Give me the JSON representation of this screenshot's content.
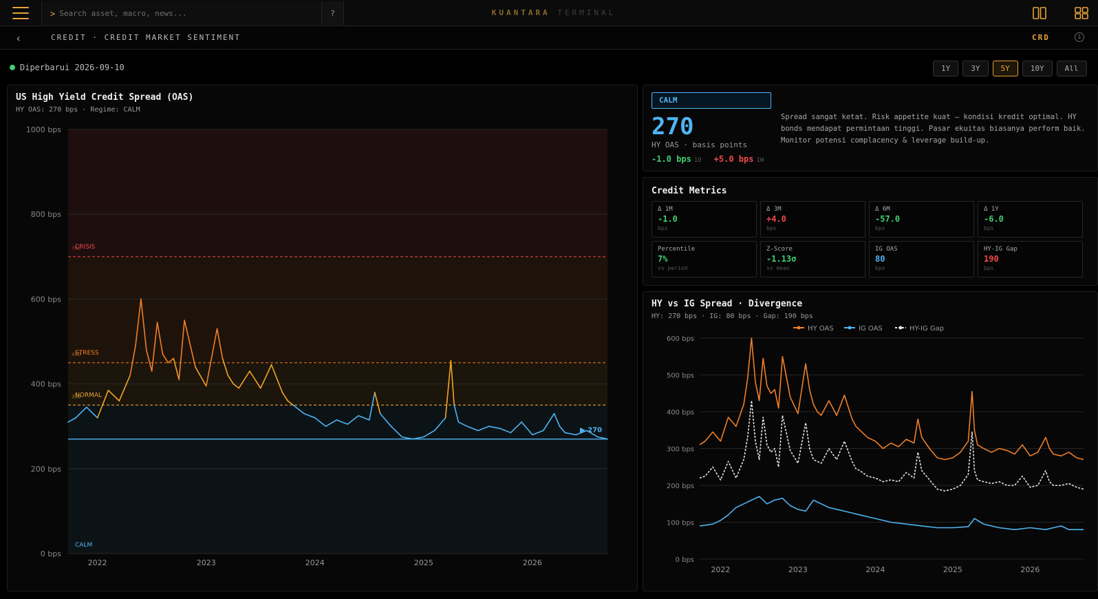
{
  "topbar": {
    "search_placeholder": "Search asset, macro, news...",
    "help_label": "?",
    "brand_primary": "KUANTARA",
    "brand_secondary": "TERMINAL"
  },
  "subbar": {
    "breadcrumb": "CREDIT · CREDIT MARKET SENTIMENT",
    "code": "CRD",
    "info_icon": "i"
  },
  "status": {
    "updated": "Diperbarui 2026-09-10"
  },
  "ranges": {
    "items": [
      "1Y",
      "3Y",
      "5Y",
      "10Y",
      "All"
    ],
    "active": "5Y"
  },
  "colors": {
    "accent": "#e8a23a",
    "calm": "#4fb4f2",
    "positive": "#3fcf72",
    "negative": "#ee4b4b",
    "hy": "#f07f2a"
  },
  "oas_panel": {
    "title": "US High Yield Credit Spread (OAS)",
    "subtitle": "HY OAS: 270 bps · Regime: CALM",
    "current_label": "▶ 270"
  },
  "summary": {
    "regime": "CALM",
    "value": "270",
    "unit_label": "HY OAS · basis points",
    "change_1d": "-1.0 bps",
    "change_1d_tag": "1D",
    "change_1w": "+5.0 bps",
    "change_1w_tag": "1W",
    "description": "Spread sangat ketat. Risk appetite kuat — kondisi kredit optimal. HY bonds mendapat permintaan tinggi. Pasar ekuitas biasanya perform baik. Monitor potensi complacency & leverage build-up."
  },
  "metrics": {
    "title": "Credit Metrics",
    "items": [
      {
        "label": "Δ 1M",
        "value": "-1.0",
        "unit": "bps",
        "tone": "neg"
      },
      {
        "label": "Δ 3M",
        "value": "+4.0",
        "unit": "bps",
        "tone": "pos"
      },
      {
        "label": "Δ 6M",
        "value": "-57.0",
        "unit": "bps",
        "tone": "neg"
      },
      {
        "label": "Δ 1Y",
        "value": "-6.0",
        "unit": "bps",
        "tone": "neg"
      },
      {
        "label": "Percentile",
        "value": "7%",
        "unit": "vs period",
        "tone": "neg"
      },
      {
        "label": "Z-Score",
        "value": "-1.13σ",
        "unit": "vs mean",
        "tone": "neg"
      },
      {
        "label": "IG OAS",
        "value": "80",
        "unit": "bps",
        "tone": "blue"
      },
      {
        "label": "HY-IG Gap",
        "value": "190",
        "unit": "bps",
        "tone": "pos"
      }
    ]
  },
  "divergence_panel": {
    "title": "HY vs IG Spread · Divergence",
    "subtitle": "HY: 270 bps · IG: 80 bps · Gap: 190 bps"
  },
  "chart_data": [
    {
      "type": "line",
      "title": "US High Yield Credit Spread (OAS)",
      "ylim": [
        0,
        1000
      ],
      "y_ticks": [
        "0 bps",
        "200 bps",
        "400 bps",
        "600 bps",
        "800 bps",
        "1000 bps"
      ],
      "x_ticks": [
        "2022",
        "2023",
        "2024",
        "2025",
        "2026"
      ],
      "x_tick_values": [
        2022,
        2023,
        2024,
        2025,
        2026
      ],
      "xlim": [
        2021.73,
        2026.69
      ],
      "zones": [
        {
          "label": "CALM",
          "from": 0,
          "to": 350,
          "color": "#4fb4f2"
        },
        {
          "label": "NORMAL",
          "from": 350,
          "to": 450,
          "color": "#e8a23a"
        },
        {
          "label": "STRESS",
          "from": 450,
          "to": 700,
          "color": "#f07f2a"
        },
        {
          "label": "CRISIS",
          "from": 700,
          "to": 1000,
          "color": "#ee4b4b"
        }
      ],
      "thresholds": [
        {
          "value": 350,
          "label": "NORMAL",
          "tick": "350",
          "color": "#e8a23a"
        },
        {
          "value": 450,
          "label": "STRESS",
          "tick": "450",
          "color": "#f07f2a"
        },
        {
          "value": 700,
          "label": "CRISIS",
          "tick": "700",
          "color": "#ee4b4b"
        }
      ],
      "current_value": 270,
      "series": [
        {
          "x": [
            2021.73,
            2021.8,
            2021.9,
            2022.0,
            2022.1,
            2022.2,
            2022.3,
            2022.35,
            2022.4,
            2022.45,
            2022.5,
            2022.55,
            2022.6,
            2022.65,
            2022.7,
            2022.75,
            2022.8,
            2022.9,
            2023.0,
            2023.1,
            2023.15,
            2023.2,
            2023.25,
            2023.3,
            2023.4,
            2023.5,
            2023.6,
            2023.7,
            2023.75,
            2023.8,
            2023.9,
            2024.0,
            2024.1,
            2024.2,
            2024.3,
            2024.4,
            2024.5,
            2024.55,
            2024.6,
            2024.7,
            2024.8,
            2024.9,
            2025.0,
            2025.1,
            2025.2,
            2025.25,
            2025.28,
            2025.32,
            2025.4,
            2025.5,
            2025.6,
            2025.7,
            2025.8,
            2025.9,
            2026.0,
            2026.1,
            2026.2,
            2026.25,
            2026.3,
            2026.4,
            2026.5,
            2026.6,
            2026.69
          ],
          "values": [
            310,
            320,
            345,
            320,
            385,
            360,
            420,
            490,
            600,
            480,
            430,
            545,
            470,
            450,
            460,
            410,
            550,
            440,
            395,
            530,
            460,
            420,
            400,
            390,
            430,
            390,
            445,
            380,
            360,
            350,
            330,
            320,
            300,
            315,
            305,
            325,
            315,
            380,
            330,
            300,
            275,
            270,
            275,
            290,
            320,
            455,
            350,
            310,
            300,
            290,
            300,
            295,
            285,
            310,
            280,
            290,
            330,
            300,
            285,
            280,
            290,
            275,
            270
          ]
        }
      ]
    },
    {
      "type": "line",
      "title": "HY vs IG Spread · Divergence",
      "ylim": [
        0,
        600
      ],
      "y_ticks": [
        "0 bps",
        "100 bps",
        "200 bps",
        "300 bps",
        "400 bps",
        "500 bps",
        "600 bps"
      ],
      "x_ticks": [
        "2022",
        "2023",
        "2024",
        "2025",
        "2026"
      ],
      "x_tick_values": [
        2022,
        2023,
        2024,
        2025,
        2026
      ],
      "xlim": [
        2021.73,
        2026.69
      ],
      "series": [
        {
          "name": "HY OAS",
          "color": "#f07f2a",
          "dashed": false,
          "x": [
            2021.73,
            2021.8,
            2021.9,
            2022.0,
            2022.1,
            2022.2,
            2022.3,
            2022.35,
            2022.4,
            2022.45,
            2022.5,
            2022.55,
            2022.6,
            2022.65,
            2022.7,
            2022.75,
            2022.8,
            2022.9,
            2023.0,
            2023.1,
            2023.15,
            2023.2,
            2023.25,
            2023.3,
            2023.4,
            2023.5,
            2023.6,
            2023.7,
            2023.75,
            2023.8,
            2023.9,
            2024.0,
            2024.1,
            2024.2,
            2024.3,
            2024.4,
            2024.5,
            2024.55,
            2024.6,
            2024.7,
            2024.8,
            2024.9,
            2025.0,
            2025.1,
            2025.2,
            2025.25,
            2025.28,
            2025.32,
            2025.4,
            2025.5,
            2025.6,
            2025.7,
            2025.8,
            2025.9,
            2026.0,
            2026.1,
            2026.2,
            2026.25,
            2026.3,
            2026.4,
            2026.5,
            2026.6,
            2026.69
          ],
          "values": [
            310,
            320,
            345,
            320,
            385,
            360,
            420,
            490,
            600,
            480,
            430,
            545,
            470,
            450,
            460,
            410,
            550,
            440,
            395,
            530,
            460,
            420,
            400,
            390,
            430,
            390,
            445,
            380,
            360,
            350,
            330,
            320,
            300,
            315,
            305,
            325,
            315,
            380,
            330,
            300,
            275,
            270,
            275,
            290,
            320,
            455,
            350,
            310,
            300,
            290,
            300,
            295,
            285,
            310,
            280,
            290,
            330,
            300,
            285,
            280,
            290,
            275,
            270
          ]
        },
        {
          "name": "IG OAS",
          "color": "#4fb4f2",
          "dashed": false,
          "x": [
            2021.73,
            2021.9,
            2022.0,
            2022.1,
            2022.2,
            2022.3,
            2022.4,
            2022.5,
            2022.6,
            2022.7,
            2022.8,
            2022.9,
            2023.0,
            2023.1,
            2023.2,
            2023.3,
            2023.4,
            2023.5,
            2023.6,
            2023.7,
            2023.8,
            2023.9,
            2024.0,
            2024.2,
            2024.4,
            2024.6,
            2024.8,
            2025.0,
            2025.2,
            2025.28,
            2025.4,
            2025.6,
            2025.8,
            2026.0,
            2026.2,
            2026.4,
            2026.5,
            2026.69
          ],
          "values": [
            90,
            95,
            105,
            120,
            140,
            150,
            160,
            170,
            150,
            160,
            165,
            145,
            135,
            130,
            160,
            150,
            140,
            135,
            130,
            125,
            120,
            115,
            110,
            100,
            95,
            90,
            85,
            85,
            88,
            110,
            95,
            85,
            80,
            85,
            80,
            90,
            80,
            80
          ]
        },
        {
          "name": "HY-IG Gap",
          "color": "#e6e6e6",
          "dashed": true,
          "x": [
            2021.73,
            2021.8,
            2021.9,
            2022.0,
            2022.1,
            2022.2,
            2022.3,
            2022.35,
            2022.4,
            2022.45,
            2022.5,
            2022.55,
            2022.6,
            2022.65,
            2022.7,
            2022.75,
            2022.8,
            2022.9,
            2023.0,
            2023.1,
            2023.15,
            2023.2,
            2023.25,
            2023.3,
            2023.4,
            2023.5,
            2023.6,
            2023.7,
            2023.75,
            2023.8,
            2023.9,
            2024.0,
            2024.1,
            2024.2,
            2024.3,
            2024.4,
            2024.5,
            2024.55,
            2024.6,
            2024.7,
            2024.8,
            2024.9,
            2025.0,
            2025.1,
            2025.2,
            2025.25,
            2025.28,
            2025.32,
            2025.4,
            2025.5,
            2025.6,
            2025.7,
            2025.8,
            2025.9,
            2026.0,
            2026.1,
            2026.2,
            2026.25,
            2026.3,
            2026.4,
            2026.5,
            2026.6,
            2026.69
          ],
          "values": [
            220,
            225,
            250,
            215,
            265,
            220,
            270,
            330,
            430,
            320,
            270,
            385,
            310,
            290,
            300,
            250,
            390,
            295,
            260,
            370,
            300,
            270,
            265,
            260,
            300,
            270,
            320,
            265,
            245,
            240,
            225,
            220,
            210,
            215,
            210,
            235,
            220,
            290,
            240,
            215,
            190,
            185,
            190,
            200,
            230,
            345,
            240,
            215,
            210,
            205,
            210,
            200,
            200,
            225,
            195,
            200,
            240,
            210,
            200,
            200,
            205,
            195,
            190
          ]
        }
      ]
    }
  ]
}
